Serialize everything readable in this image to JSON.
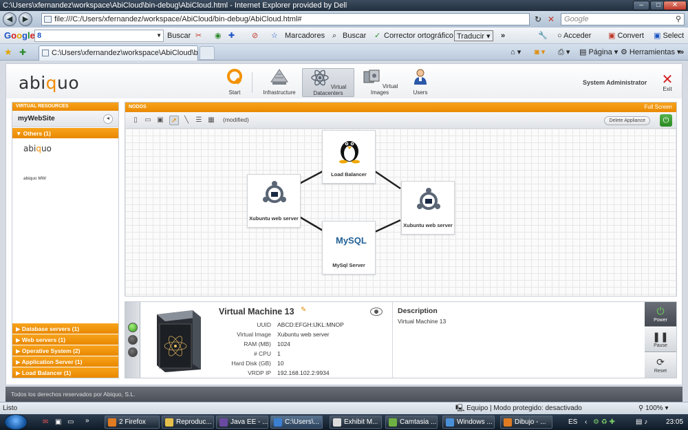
{
  "window": {
    "title": "C:\\Users\\xfernandez\\workspace\\AbiCloud\\bin-debug\\AbiCloud.html - Internet Explorer provided by Dell",
    "url": "file:///C:/Users/xfernandez/workspace/AbiCloud/bin-debug/AbiCloud.html#",
    "search_placeholder": "Google",
    "tab_title": "C:\\Users\\xfernandez\\workspace\\AbiCloud\\bin-d...",
    "minimize": "–",
    "maximize": "□",
    "close": "✕"
  },
  "google_toolbar": {
    "logo": "Google",
    "g_label": "8",
    "buscar": "Buscar",
    "marcadores": "Marcadores",
    "buscar2": "Buscar",
    "corrector": "Corrector ortográfico",
    "traducir": "Traducir",
    "more": "»",
    "acceder": "Acceder",
    "convert": "Convert",
    "select": "Select"
  },
  "ie_commands": {
    "pagina": "Página",
    "herramientas": "Herramientas",
    "more": "»"
  },
  "app": {
    "logo_prefix": "abi",
    "logo_highlight": "q",
    "logo_suffix": "uo",
    "nav": [
      {
        "label": "Start",
        "icon": "start-icon"
      },
      {
        "label": "Infrastructure",
        "icon": "infrastructure-icon"
      },
      {
        "label": "Virtual Datacenters",
        "icon": "virtual-datacenters-icon"
      },
      {
        "label": "Virtual Images",
        "icon": "virtual-images-icon"
      },
      {
        "label": "Users",
        "icon": "users-icon"
      }
    ],
    "user": "System Administrator",
    "exit": "Exit"
  },
  "left_panel": {
    "header": "VIRTUAL RESOURCES",
    "vdc_name": "myWebSite",
    "collapse": "◄",
    "others": "▼ Others  (1)",
    "lib_logo_prefix": "abi",
    "lib_logo_highlight": "q",
    "lib_logo_suffix": "uo",
    "lib_item": "abiquo MW",
    "groups": [
      "▶ Database servers  (1)",
      "▶ Web servers  (1)",
      "▶ Operative System  (2)",
      "▶ Application Server  (1)",
      "▶ Load Balancer  (1)"
    ]
  },
  "canvas": {
    "header": "NODOS",
    "full_screen": "Full Screen",
    "modified": "(modified)",
    "delete_appliance": "Delete Appliance",
    "nodes": {
      "load_balancer": "Load Balancer",
      "web1": "Xubuntu web server",
      "web2": "Xubuntu web server",
      "mysql": "MySql Server"
    },
    "mysql_logo": "MySQL"
  },
  "detail": {
    "title": "Virtual Machine 13",
    "props": [
      {
        "k": "UUID",
        "v": "ABCD:EFGH:IJKL:MNOP"
      },
      {
        "k": "Virtual Image",
        "v": "Xubuntu web server"
      },
      {
        "k": "RAM (MB)",
        "v": "1024"
      },
      {
        "k": "# CPU",
        "v": "1"
      },
      {
        "k": "Hard Disk (GB)",
        "v": "10"
      },
      {
        "k": "VRDP IP",
        "v": "192.168.102.2:9934"
      }
    ],
    "description_title": "Description",
    "description": "Virtual Machine 13",
    "power": "Power",
    "pause": "Pause",
    "reset": "Reset"
  },
  "footer": "Todos los derechos reservados por Abiquo, S.L.",
  "statusbar": {
    "left": "Listo",
    "zone": "Equipo | Modo protegido: desactivado",
    "zoom": "100%"
  },
  "taskbar": {
    "tasks": [
      "2 Firefox",
      "Reproduc...",
      "Java EE - ...",
      "C:\\Users\\...",
      "Exhibit M...",
      "Camtasia ...",
      "Windows ...",
      "Dibujo - ..."
    ],
    "lang": "ES",
    "clock": "23:05",
    "more": "»"
  },
  "colors": {
    "accent_orange": "#f39200",
    "power_green": "#2a8a22"
  }
}
